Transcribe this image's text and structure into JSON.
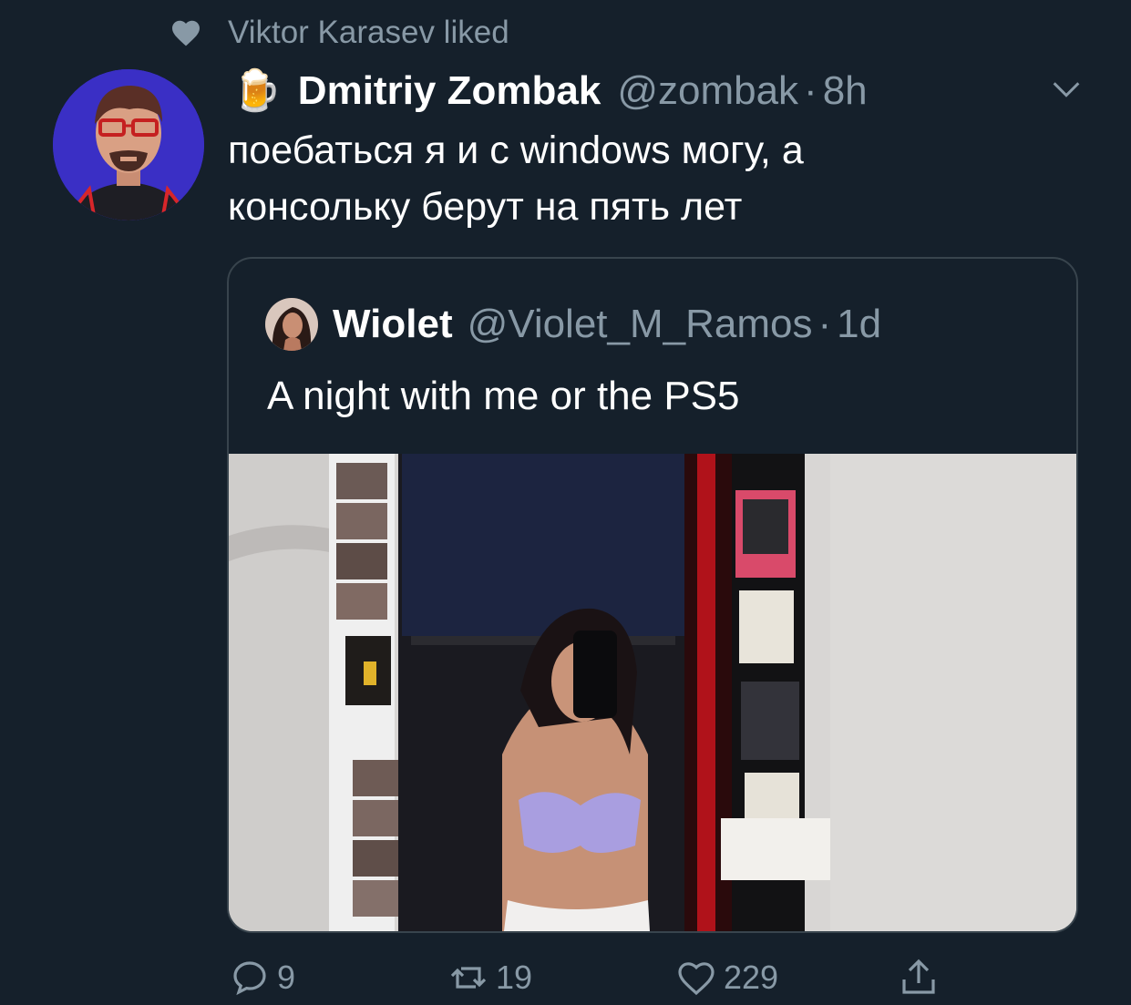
{
  "social_context": {
    "text": "Viktor Karasev liked",
    "icon": "heart-icon"
  },
  "tweet": {
    "emoji": "🍺",
    "display_name": "Dmitriy Zombak",
    "handle": "@zombak",
    "separator": "·",
    "time": "8h",
    "text_lines": [
      "поебаться я и с windows могу, а",
      "консольку берут на пять лет"
    ]
  },
  "quoted": {
    "display_name": "Wiolet",
    "handle": "@Violet_M_Ramos",
    "separator": "·",
    "time": "1d",
    "text": "A night with me or the PS5"
  },
  "actions": {
    "replies": "9",
    "retweets": "19",
    "likes": "229"
  },
  "colors": {
    "background": "#15202b",
    "muted": "#8899a6",
    "border": "#38444d",
    "text": "#ffffff"
  }
}
